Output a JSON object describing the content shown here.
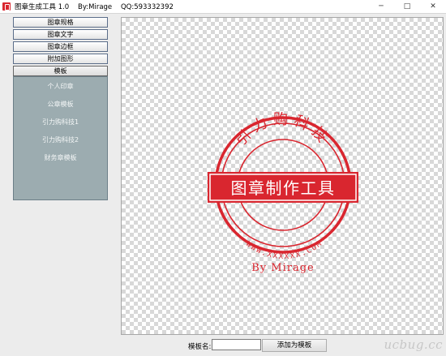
{
  "window": {
    "title": "图章生成工具 1.0    By:Mirage    QQ:593332392",
    "controls": {
      "minimize": "─",
      "maximize": "□",
      "close": "✕"
    }
  },
  "sidebar": {
    "buttons": [
      {
        "label": "图章规格"
      },
      {
        "label": "图章文字"
      },
      {
        "label": "图章边框"
      },
      {
        "label": "附加图形"
      },
      {
        "label": "模板"
      }
    ],
    "template_items": [
      {
        "label": "个人印章"
      },
      {
        "label": "公章模板"
      },
      {
        "label": "引力购科技1"
      },
      {
        "label": "引力购科技2"
      },
      {
        "label": "财务章模板"
      }
    ]
  },
  "seal": {
    "color": "#d9262f",
    "arc_top_text": "引力购科技",
    "banner_text": "图章制作工具",
    "arc_bottom_text": "WWW.XXXXXX.COM",
    "signature": "By Mirage"
  },
  "bottom_bar": {
    "name_label": "模板名:",
    "name_value": "",
    "add_button": "添加为模板"
  },
  "watermark": "ucbug.cc"
}
